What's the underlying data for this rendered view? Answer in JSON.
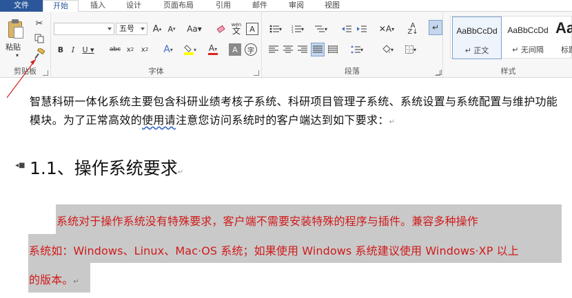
{
  "tabs": [
    {
      "label": "文件"
    },
    {
      "label": "开始"
    },
    {
      "label": "插入"
    },
    {
      "label": "设计"
    },
    {
      "label": "页面布局"
    },
    {
      "label": "引用"
    },
    {
      "label": "邮件"
    },
    {
      "label": "审阅"
    },
    {
      "label": "视图"
    }
  ],
  "ribbon": {
    "clipboard": {
      "paste_label": "粘贴",
      "group_label": "剪贴板"
    },
    "font": {
      "font_name": "",
      "font_size": "五号",
      "group_label": "字体",
      "wen_label": "wén",
      "wen_char": "文"
    },
    "paragraph": {
      "group_label": "段落"
    },
    "styles": {
      "group_label": "样式",
      "items": [
        {
          "sample": "AaBbCcDd",
          "name": "↵ 正文"
        },
        {
          "sample": "AaBbCcDd",
          "name": "↵ 无间隔"
        },
        {
          "sample": "AaB",
          "name": "标题"
        }
      ]
    }
  },
  "document": {
    "para1_a": "智慧科研一体化系统主要包含科研业绩考核子系统、科研项目管理子系统、系统设置与系统配置与维护功能模块。为了正常高效的",
    "para1_squiggle": "使用请",
    "para1_b": "注意您访问系统时的客户端达到如下要求：",
    "heading": "1.1、操作系统要求",
    "body_lines": [
      "系统对于操作系统没有特殊要求，客户端不需要安装特殊的程序与插件。兼容多种操作",
      "系统如：Windows、Linux、Mac·OS 系统；如果使用 Windows 系统建议使用 Windows·XP 以上",
      "的版本。"
    ],
    "para_mark": "↵"
  },
  "colors": {
    "accent": "#2b579a",
    "body_red": "#d01a1a",
    "highlight_gray": "#c9c9c9",
    "annotation_red": "#d02020"
  }
}
